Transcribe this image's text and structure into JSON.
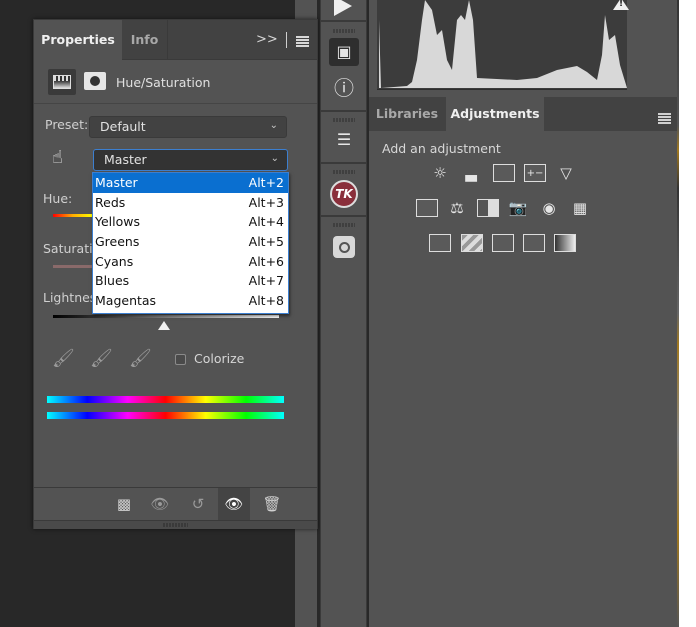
{
  "properties_panel": {
    "tabs": [
      {
        "label": "Properties",
        "active": true
      },
      {
        "label": "Info",
        "active": false
      }
    ],
    "collapse_label": ">>",
    "adjustment_title": "Hue/Saturation",
    "preset_label": "Preset:",
    "preset_value": "Default",
    "channel_value": "Master",
    "hue_label": "Hue:",
    "saturation_label": "Saturation:",
    "lightness_label": "Lightness:",
    "colorize_label": "Colorize",
    "colorize_checked": false
  },
  "channel_dropdown": {
    "selected": "Master",
    "options": [
      {
        "label": "Master",
        "shortcut": "Alt+2"
      },
      {
        "label": "Reds",
        "shortcut": "Alt+3"
      },
      {
        "label": "Yellows",
        "shortcut": "Alt+4"
      },
      {
        "label": "Greens",
        "shortcut": "Alt+5"
      },
      {
        "label": "Cyans",
        "shortcut": "Alt+6"
      },
      {
        "label": "Blues",
        "shortcut": "Alt+7"
      },
      {
        "label": "Magentas",
        "shortcut": "Alt+8"
      }
    ]
  },
  "footer_icons": [
    "clip-to-layer-icon",
    "view-previous-icon",
    "reset-icon",
    "visibility-eye-icon",
    "trash-icon"
  ],
  "tool_strip": {
    "icons": [
      "play-icon",
      "3d-icon",
      "info-icon",
      "stamp-list-icon",
      "tk-plugin-icon",
      "instagram-icon"
    ],
    "tk_label": "TK"
  },
  "right_panel": {
    "tabs": [
      {
        "label": "Libraries",
        "active": false
      },
      {
        "label": "Adjustments",
        "active": true
      }
    ],
    "add_adjustment_label": "Add an adjustment",
    "adjustment_icons_row1": [
      "brightness-contrast-icon",
      "levels-icon",
      "curves-icon",
      "exposure-icon",
      "vibrance-icon"
    ],
    "adjustment_icons_row2": [
      "hue-saturation-icon",
      "color-balance-icon",
      "black-white-icon",
      "photo-filter-icon",
      "channel-mixer-icon",
      "color-lookup-icon"
    ],
    "adjustment_icons_row3": [
      "invert-icon",
      "posterize-icon",
      "threshold-icon",
      "selective-color-icon",
      "gradient-map-icon"
    ]
  }
}
